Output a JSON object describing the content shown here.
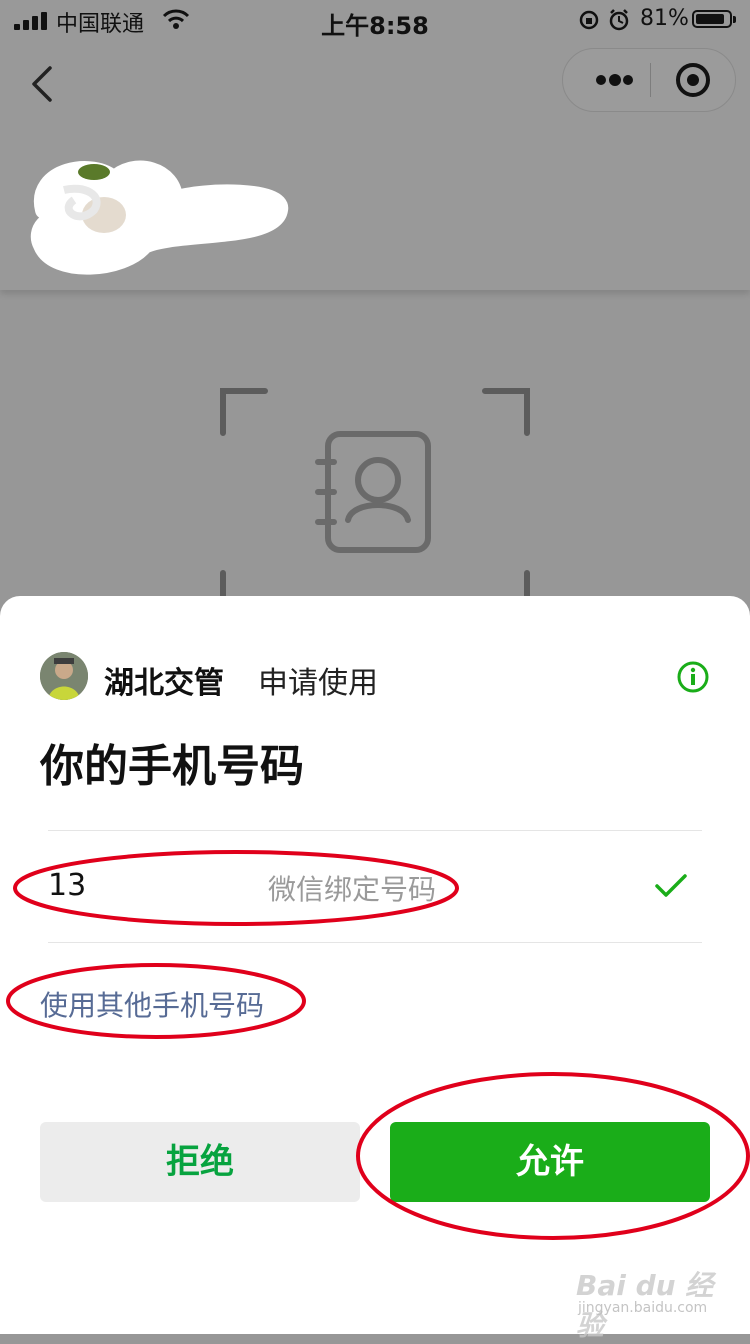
{
  "status_bar": {
    "carrier": "中国联通",
    "time": "上午8:58",
    "battery_percent": "81%"
  },
  "nav": {
    "back_icon": "chevron-left-icon",
    "more_icon": "more-dots-icon",
    "close_icon": "target-circle-icon"
  },
  "auth_sheet": {
    "app_name": "湖北交管",
    "request_text": "申请使用",
    "title": "你的手机号码",
    "phone": {
      "number": "13",
      "note": "微信绑定号码",
      "selected": true
    },
    "other_phone_link": "使用其他手机号码",
    "buttons": {
      "deny": "拒绝",
      "allow": "允许"
    }
  },
  "watermark": {
    "brand": "Bai du 经验",
    "url": "jingyan.baidu.com"
  },
  "colors": {
    "accent_green": "#1aad19",
    "link_blue": "#576b95",
    "annotation_red": "#e0001b",
    "overlay_gray": "#979797"
  }
}
